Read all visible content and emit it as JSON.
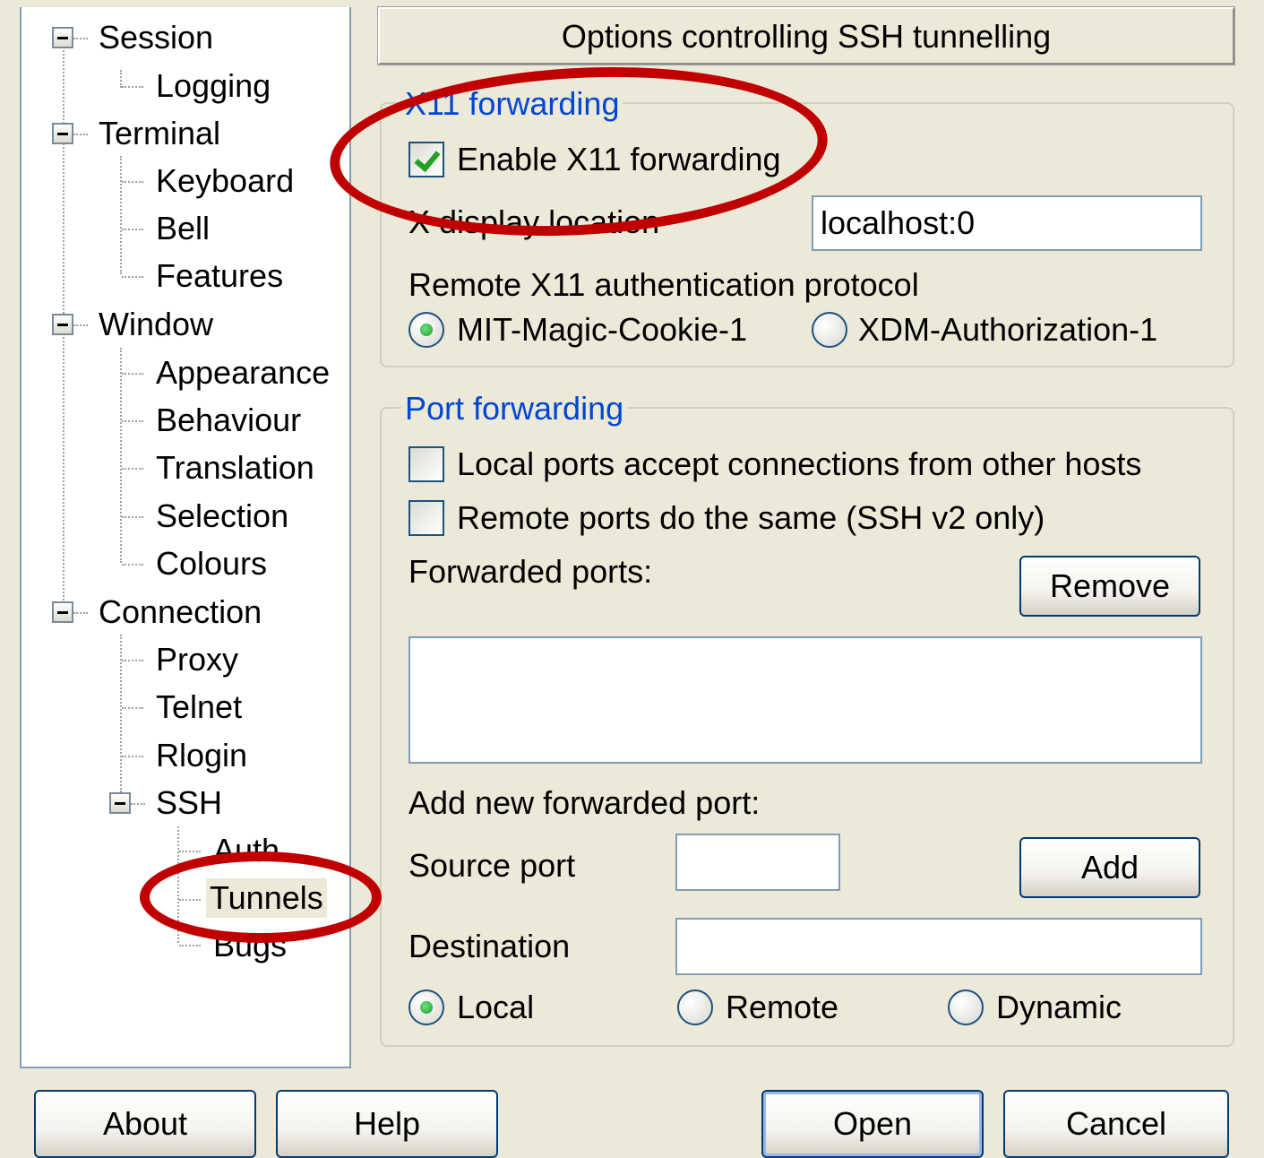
{
  "header": {
    "title": "Options controlling SSH tunnelling"
  },
  "tree": {
    "session": "Session",
    "logging": "Logging",
    "terminal": "Terminal",
    "keyboard": "Keyboard",
    "bell": "Bell",
    "features": "Features",
    "window": "Window",
    "appearance": "Appearance",
    "behaviour": "Behaviour",
    "translation": "Translation",
    "selection": "Selection",
    "colours": "Colours",
    "connection": "Connection",
    "proxy": "Proxy",
    "telnet": "Telnet",
    "rlogin": "Rlogin",
    "ssh": "SSH",
    "auth": "Auth",
    "tunnels": "Tunnels",
    "bugs": "Bugs"
  },
  "x11": {
    "group_title": "X11 forwarding",
    "enable_label": "Enable X11 forwarding",
    "enable_checked": true,
    "display_label": "X display location",
    "display_value": "localhost:0",
    "auth_label": "Remote X11 authentication protocol",
    "auth_mit": "MIT-Magic-Cookie-1",
    "auth_xdm": "XDM-Authorization-1",
    "auth_selected": "MIT-Magic-Cookie-1"
  },
  "port": {
    "group_title": "Port forwarding",
    "local_accept_label": "Local ports accept connections from other hosts",
    "remote_same_label": "Remote ports do the same (SSH v2 only)",
    "forwarded_label": "Forwarded ports:",
    "remove_button": "Remove",
    "add_new_label": "Add new forwarded port:",
    "source_label": "Source port",
    "source_value": "",
    "add_button": "Add",
    "destination_label": "Destination",
    "destination_value": "",
    "radio_local": "Local",
    "radio_remote": "Remote",
    "radio_dynamic": "Dynamic",
    "selected": "Local"
  },
  "footer": {
    "about": "About",
    "help": "Help",
    "open": "Open",
    "cancel": "Cancel"
  },
  "colors": {
    "annotation": "#c00000",
    "group_title": "#0046d5",
    "checkmark": "#21a121"
  }
}
